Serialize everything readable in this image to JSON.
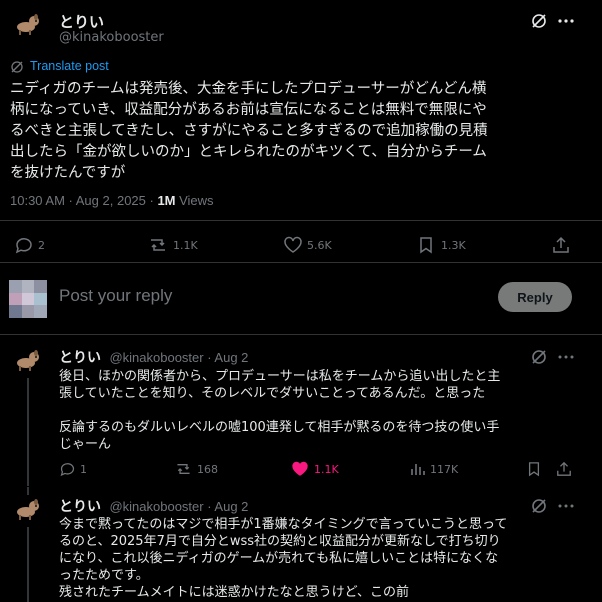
{
  "post": {
    "author_name": "とりい",
    "author_handle": "@kinakobooster",
    "translate_label": "Translate post",
    "text_lines": [
      "ニディガのチームは発売後、大金を手にしたプロデューサーがどんどん横",
      "柄になっていき、収益配分があるお前は宣伝になることは無料で無限にや",
      "るべきと主張してきたし、さすがにやること多すぎるので追加稼働の見積",
      "出したら「金が欲しいのか」とキレられたのがキツくて、自分からチーム",
      "を抜けたんですが"
    ],
    "timestamp": "10:30 AM · Aug 2, 2025 · ",
    "views_count": "1M",
    "views_label": " Views",
    "stats": {
      "replies": "2",
      "reposts": "1.1K",
      "likes": "5.6K",
      "bookmarks": "1.3K"
    }
  },
  "composer": {
    "placeholder": "Post your reply",
    "button_label": "Reply"
  },
  "replies": [
    {
      "author_name": "とりい",
      "author_handle": "@kinakobooster · Aug 2",
      "text_lines": [
        "後日、ほかの関係者から、プロデューサーは私をチームから追い出したと主",
        "張していたことを知り、そのレベルでダサいことってあるんだ。と思った",
        "",
        "反論するのもダルいレベルの嘘100連発して相手が黙るのを待つ技の使い手",
        "じゃーん"
      ],
      "stats": {
        "replies": "1",
        "reposts": "168",
        "likes": "1.1K",
        "views": "117K"
      }
    },
    {
      "author_name": "とりい",
      "author_handle": "@kinakobooster · Aug 2",
      "text_lines": [
        "今まで黙ってたのはマジで相手が1番嫌なタイミングで言っていこうと思って",
        "るのと、2025年7月で自分とwss社の契約と収益配分が更新なしで打ち切り",
        "になり、これ以後ニディガのゲームが売れても私に嬉しいことは特になくな",
        "ったためです。",
        "残されたチームメイトには迷惑かけたなと思うけど、この前"
      ]
    }
  ],
  "colors": {
    "accent": "#1d9bf0",
    "like_active": "#f91880",
    "muted": "#71767b",
    "text": "#e7e9ea",
    "background": "#000000"
  }
}
